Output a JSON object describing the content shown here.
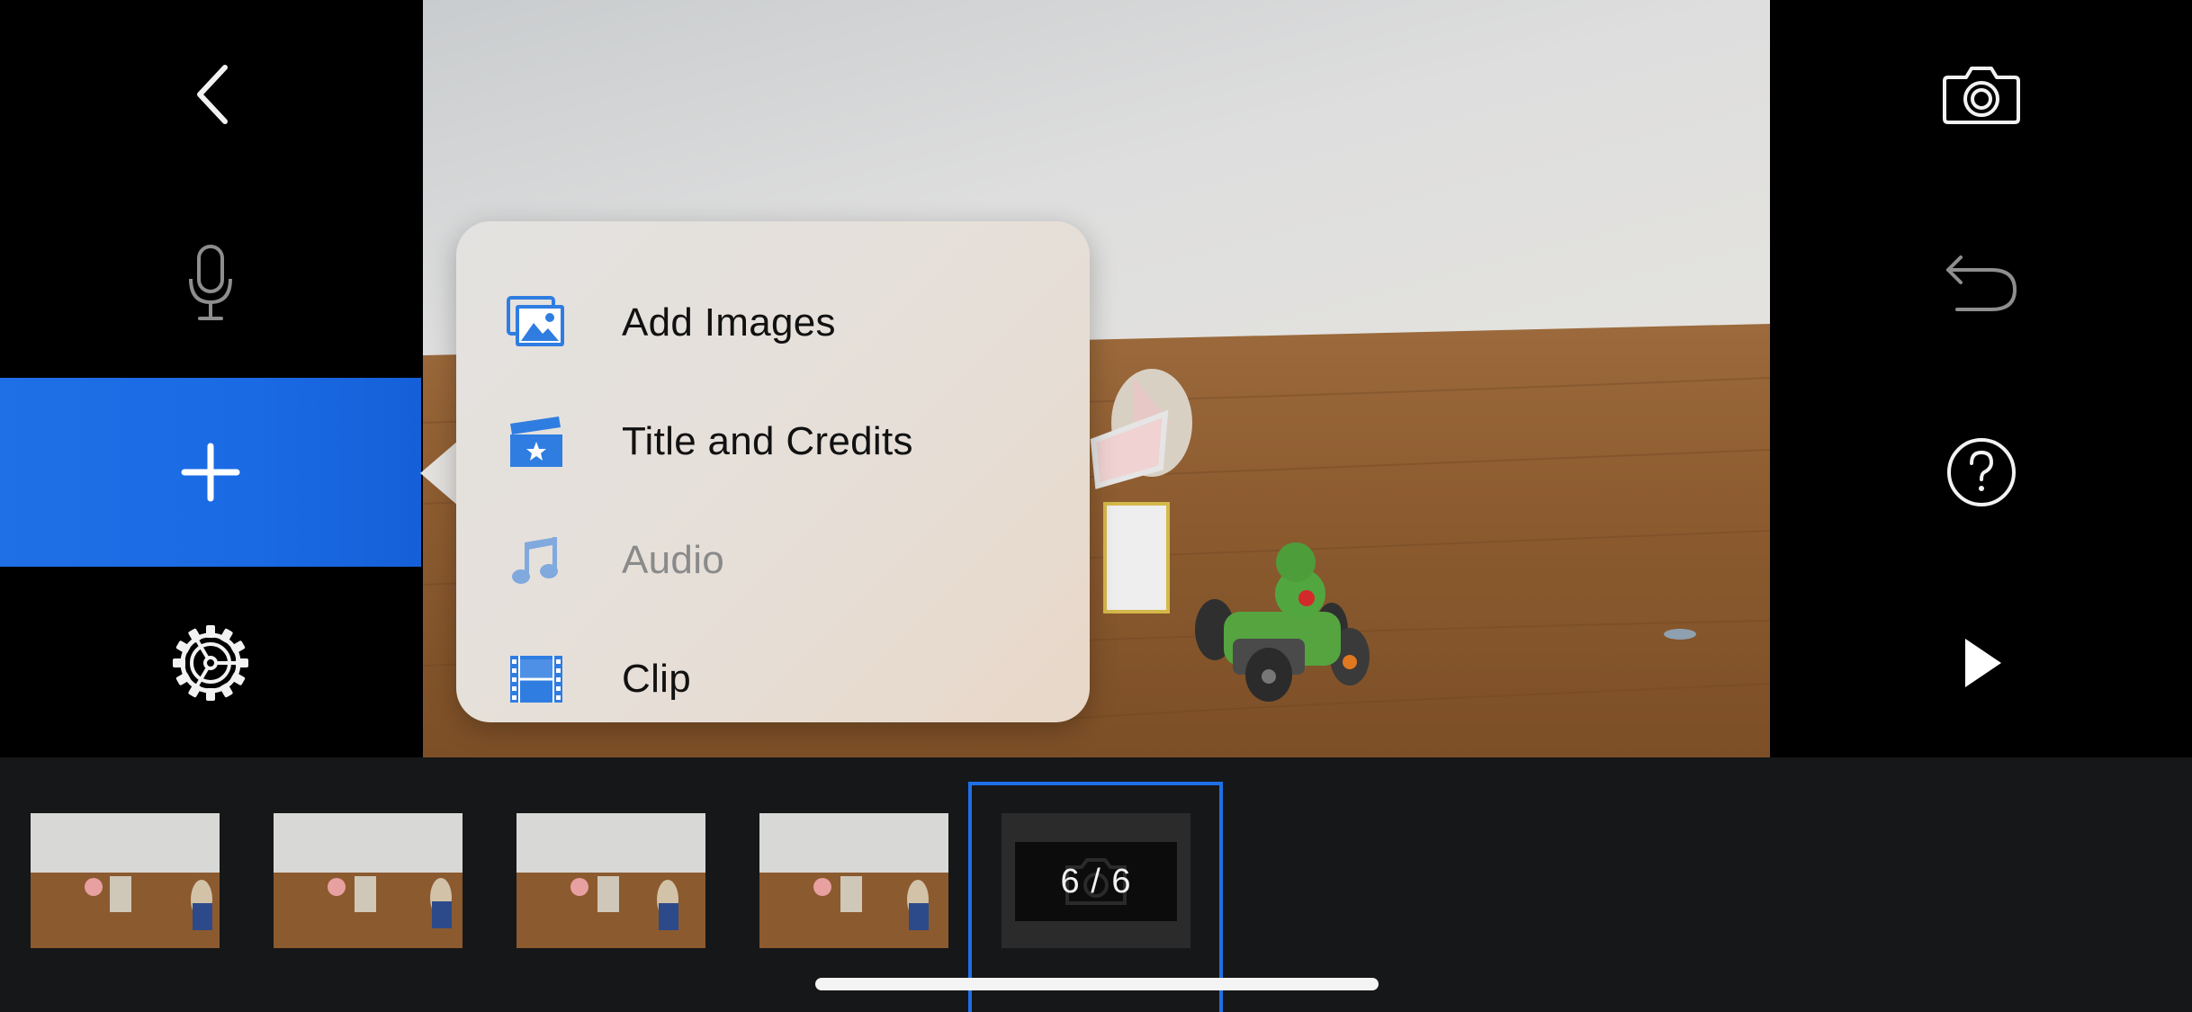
{
  "left_toolbar": {
    "back_icon": "chevron-left-icon",
    "mic_icon": "microphone-icon",
    "add_icon": "plus-icon",
    "settings_icon": "gear-icon",
    "active_color": "#1f6fe6"
  },
  "right_toolbar": {
    "camera_icon": "camera-icon",
    "undo_icon": "undo-icon",
    "help_icon": "help-icon",
    "play_icon": "play-icon"
  },
  "add_menu": {
    "items": [
      {
        "label": "Add Images",
        "icon": "images-icon",
        "enabled": true
      },
      {
        "label": "Title and Credits",
        "icon": "clapperboard-icon",
        "enabled": true
      },
      {
        "label": "Audio",
        "icon": "music-note-icon",
        "enabled": false
      },
      {
        "label": "Clip",
        "icon": "film-strip-icon",
        "enabled": true
      }
    ]
  },
  "timeline": {
    "counter_text": "6 / 6",
    "selection_color": "#1f6fe6"
  }
}
